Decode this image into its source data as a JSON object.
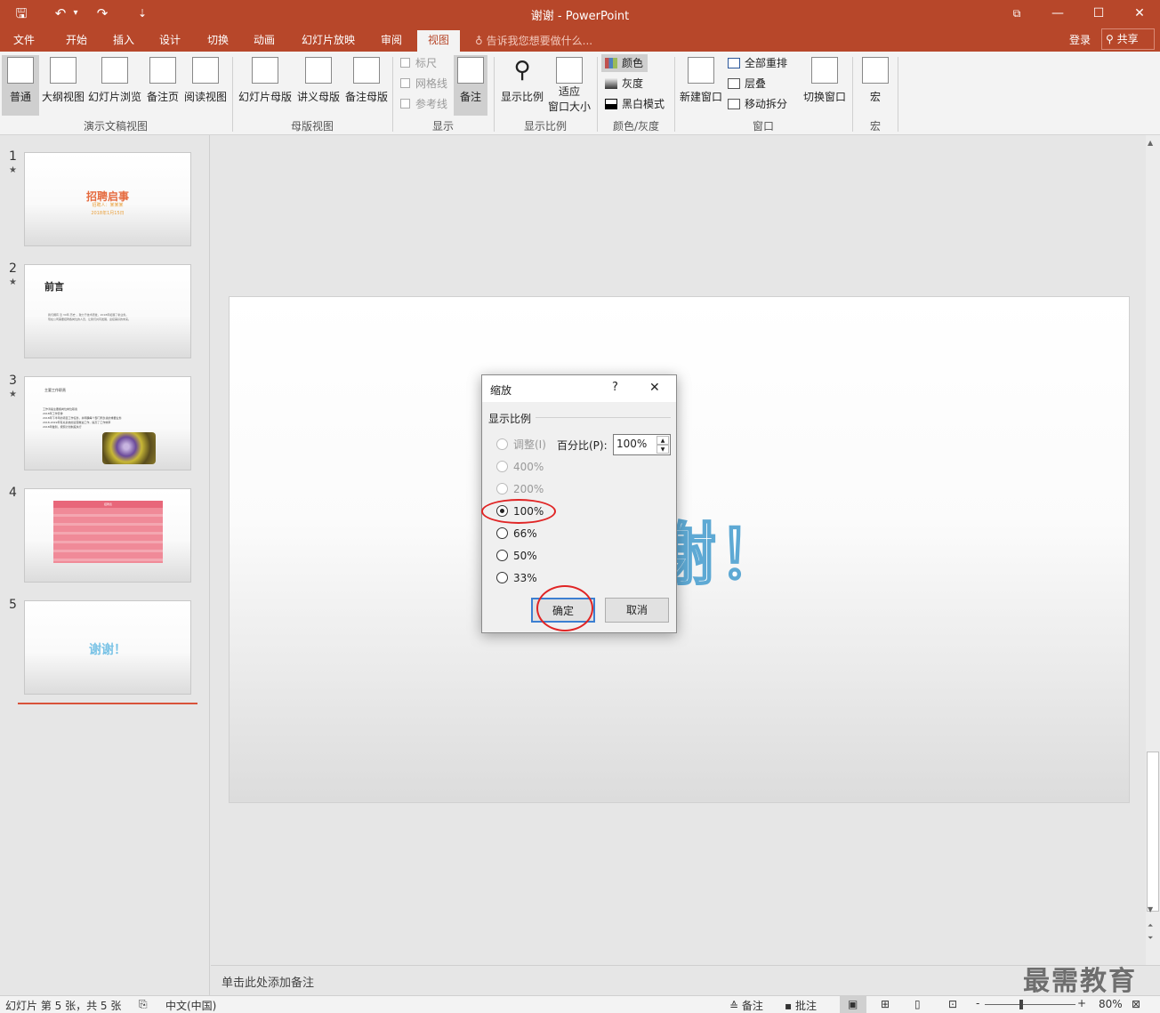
{
  "title_bar": {
    "doc": "谢谢",
    "app": " - PowerPoint",
    "sep": "-",
    "controls": {
      "restore": "⧉",
      "minimize": "—",
      "maximize": "☐",
      "close": "✕"
    }
  },
  "quick_access": {
    "save": "🖫",
    "undo": "↶",
    "undo_dd": "▾",
    "redo": "↷",
    "customize": "⇣"
  },
  "tabs": [
    "文件",
    "开始",
    "插入",
    "设计",
    "切换",
    "动画",
    "幻灯片放映",
    "审阅",
    "视图"
  ],
  "active_tab": "视图",
  "tell_me": "告诉我您想要做什么...",
  "account": {
    "login": "登录",
    "share": "共享"
  },
  "ribbon": {
    "presentation_views": {
      "label": "演示文稿视图",
      "buttons": [
        "普通",
        "大纲视图",
        "幻灯片浏览",
        "备注页",
        "阅读视图"
      ]
    },
    "master_views": {
      "label": "母版视图",
      "buttons": [
        "幻灯片母版",
        "讲义母版",
        "备注母版"
      ]
    },
    "show": {
      "label": "显示",
      "checks": [
        "标尺",
        "网格线",
        "参考线"
      ],
      "notes": "备注"
    },
    "zoom": {
      "label": "显示比例",
      "zoom": "显示比例",
      "fit_line1": "适应",
      "fit_line2": "窗口大小"
    },
    "color": {
      "label": "颜色/灰度",
      "items": [
        "颜色",
        "灰度",
        "黑白模式"
      ]
    },
    "window": {
      "label": "窗口",
      "new_window": "新建窗口",
      "items": [
        "全部重排",
        "层叠",
        "移动拆分"
      ],
      "switch": "切换窗口"
    },
    "macros": {
      "label": "宏",
      "button": "宏"
    }
  },
  "slides": [
    {
      "num": "1",
      "title": "招聘启事",
      "sub": "招聘人：某某某",
      "date": "2018年1月15日"
    },
    {
      "num": "2",
      "title": "前言",
      "line1": "我们拥有 近 30年 历史 ，致力于技术研发，2018年拓展了新业务。",
      "line2": "现在公司需要招聘各岗位的人员，让我们共同发展，迎接美好的未来。"
    },
    {
      "num": "3",
      "title": "主要工作职责",
      "bullets": [
        "工作清楚主要各岗位岗位职责",
        "2018年工作安排",
        "2018年下半年的项目工作任务，并明确每个部门所负责的重要业务",
        "2018-2019年有关系统的运营推进工作，提高了工作效率",
        "2018年做到，按照计划制度执行"
      ]
    },
    {
      "num": "4",
      "title": "招聘表"
    },
    {
      "num": "5",
      "title": "谢谢！"
    }
  ],
  "star": "★",
  "slide_main_text": "谢谢！",
  "notes_placeholder": "单击此处添加备注",
  "status": {
    "slide_info": "幻灯片 第 5 张，共 5 张",
    "lang": "中文(中国)",
    "notes": "备注",
    "comments": "批注",
    "zoom": "80%",
    "minus": "-",
    "plus": "+"
  },
  "dialog": {
    "title": "缩放",
    "help": "?",
    "close": "✕",
    "group": "显示比例",
    "fit": "调整(I)",
    "percent_label": "百分比(P):",
    "percent_value": "100%",
    "options": [
      "400%",
      "200%",
      "100%",
      "66%",
      "50%",
      "33%"
    ],
    "selected": "100%",
    "ok": "确定",
    "cancel": "取消"
  },
  "watermark": "最需教育"
}
